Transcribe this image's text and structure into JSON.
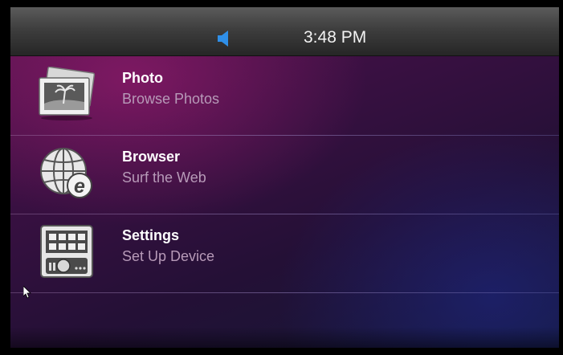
{
  "status_bar": {
    "clock": "3:48 PM",
    "volume_icon": "speaker-icon",
    "volume_color": "#2f8fe8"
  },
  "menu": {
    "items": [
      {
        "title": "Photo",
        "subtitle": "Browse Photos",
        "icon": "photo-icon"
      },
      {
        "title": "Browser",
        "subtitle": "Surf the Web",
        "icon": "globe-ie-icon"
      },
      {
        "title": "Settings",
        "subtitle": "Set Up Device",
        "icon": "control-panel-icon"
      }
    ]
  },
  "colors": {
    "title": "#ffffff",
    "subtitle": "#b79ab8",
    "background_magenta": "#5a1450",
    "background_blue": "#141838"
  }
}
